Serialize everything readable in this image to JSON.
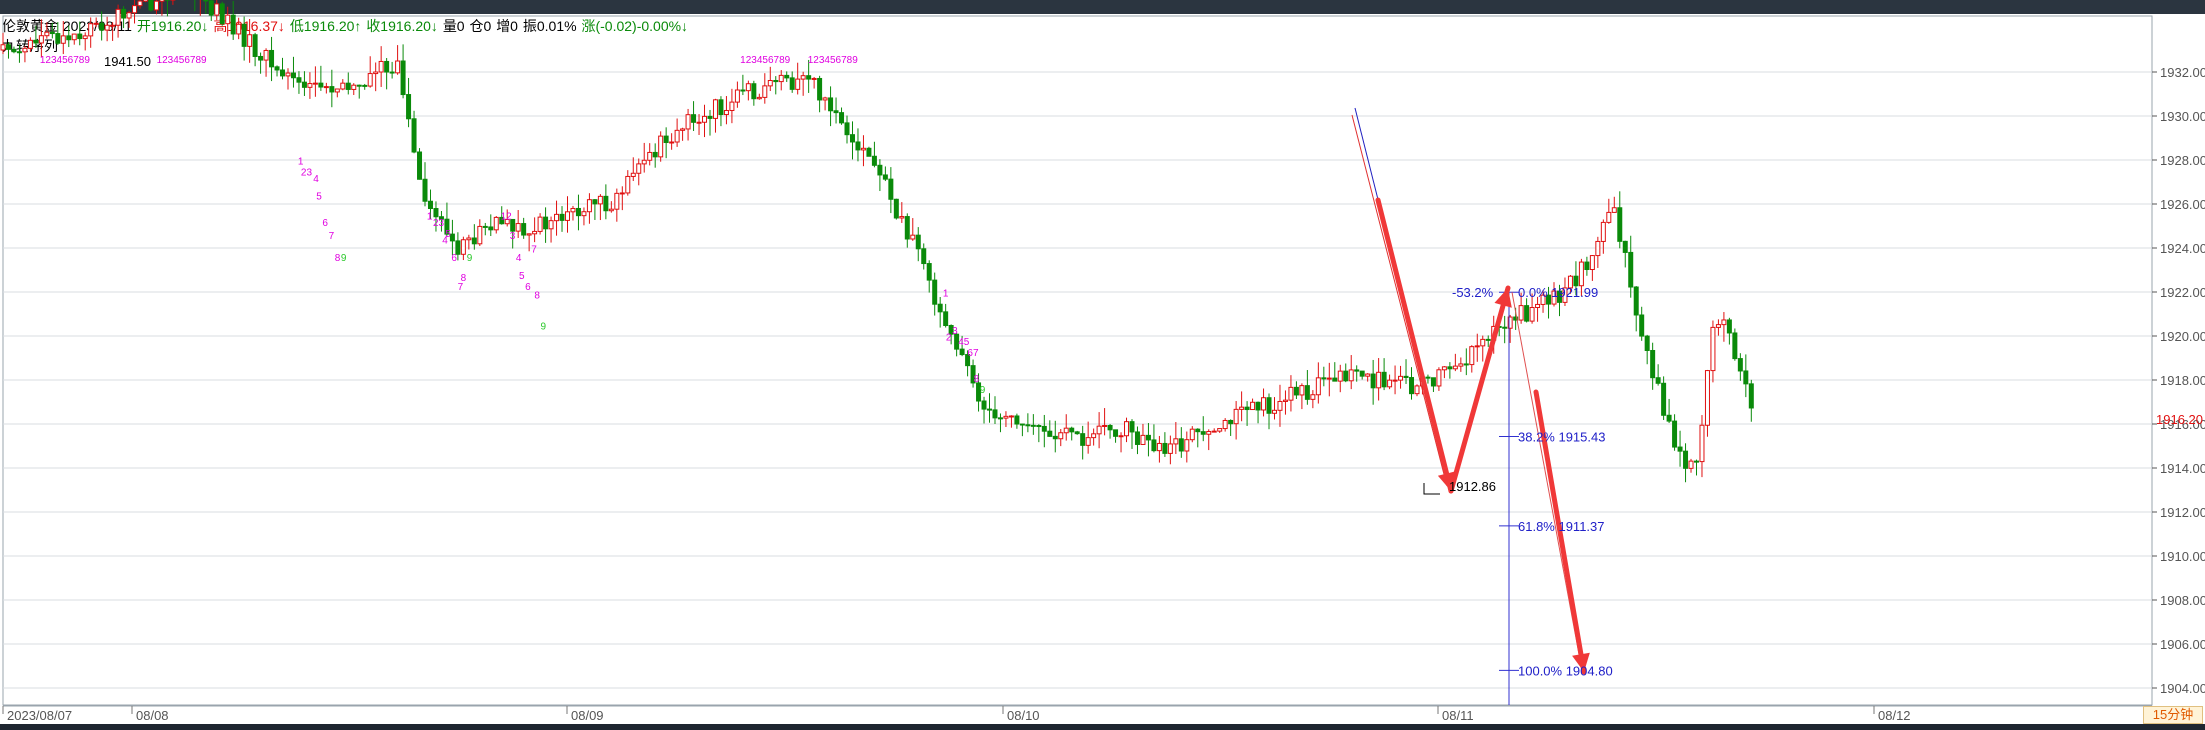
{
  "header": {
    "symbol": "伦敦黄金",
    "date": "2023/08/11",
    "open": "开1916.20↓",
    "high": "高1916.37↓",
    "low": "低1916.20↑",
    "close": "收1916.20↓",
    "volume": "量0",
    "position": "仓0",
    "increase": "增0",
    "amplitude": "振0.01%",
    "change": "涨(-0.02)-0.00%↓",
    "colors": {
      "up": "#e01010",
      "down": "#0a8a0a",
      "neutral": "#000000"
    }
  },
  "indicator": {
    "name": "九转序列"
  },
  "period": "15分钟",
  "last_price": "1916.20",
  "chart_data": {
    "type": "candlestick",
    "y_ticks": [
      "1932.00",
      "1930.00",
      "1928.00",
      "1926.00",
      "1924.00",
      "1922.00",
      "1920.00",
      "1918.00",
      "1916.00",
      "1914.00",
      "1912.00",
      "1910.00",
      "1908.00",
      "1906.00",
      "1904.00"
    ],
    "ylim": [
      1903.3,
      1933.3
    ],
    "x_labels": [
      "2023/08/07",
      "08/08",
      "08/09",
      "08/10",
      "08/11",
      "08/12"
    ],
    "grid": true,
    "close_path": [
      [
        0,
        1933
      ],
      [
        30,
        1934
      ],
      [
        60,
        1936
      ],
      [
        90,
        1932
      ],
      [
        110,
        1931
      ],
      [
        128,
        1932.5
      ],
      [
        138,
        1926
      ],
      [
        148,
        1924
      ],
      [
        160,
        1925
      ],
      [
        175,
        1925
      ],
      [
        185,
        1925.5
      ],
      [
        200,
        1926.3
      ],
      [
        215,
        1929
      ],
      [
        230,
        1930.2
      ],
      [
        245,
        1931.2
      ],
      [
        262,
        1931.8
      ],
      [
        275,
        1929.5
      ],
      [
        285,
        1927.5
      ],
      [
        300,
        1923
      ],
      [
        318,
        1917
      ],
      [
        335,
        1915.8
      ],
      [
        350,
        1915.3
      ],
      [
        365,
        1915.8
      ],
      [
        378,
        1914.6
      ],
      [
        392,
        1916
      ],
      [
        405,
        1916.5
      ],
      [
        420,
        1917.3
      ],
      [
        440,
        1918.3
      ],
      [
        460,
        1917.6
      ],
      [
        478,
        1919.2
      ],
      [
        490,
        1920.7
      ],
      [
        505,
        1921.7
      ],
      [
        516,
        1923.2
      ],
      [
        524,
        1925.8
      ],
      [
        530,
        1922.3
      ],
      [
        538,
        1918
      ],
      [
        546,
        1914.4
      ],
      [
        552,
        1914.2
      ],
      [
        556,
        1920.5
      ],
      [
        562,
        1920.2
      ],
      [
        567,
        1917.6
      ],
      [
        571,
        1916.4
      ]
    ],
    "candle_count": 320,
    "peak_label": "1941.50",
    "trough_label": "1912.86",
    "fibonacci": [
      {
        "ratio": "0.0%",
        "value": "1921.99",
        "label": "0.0% 1921.99",
        "price": 1921.99
      },
      {
        "ratio": "38.2%",
        "value": "1915.43",
        "label": "38.2% 1915.43",
        "price": 1915.43
      },
      {
        "ratio": "61.8%",
        "value": "1911.37",
        "label": "61.8% 1911.37",
        "price": 1911.37
      },
      {
        "ratio": "100.0%",
        "value": "1904.80",
        "label": "100.0% 1904.80",
        "price": 1904.8
      }
    ],
    "fib_extra_label": "-53.2%",
    "td_sequences": [
      {
        "text": "123456789",
        "color": "#e000e0",
        "price": 1932.4,
        "x": 12
      },
      {
        "text": "123456789",
        "color": "#e000e0",
        "price": 1932.4,
        "x": 50
      },
      {
        "text": "123456789",
        "color": "#e000e0",
        "price": 1932.4,
        "x": 240
      },
      {
        "text": "123456789",
        "color": "#e000e0",
        "price": 1932.4,
        "x": 262
      },
      {
        "text": "1",
        "color": "#e000e0",
        "price": 1927.8,
        "x": 96
      },
      {
        "text": "23",
        "color": "#e000e0",
        "price": 1927.3,
        "x": 97
      },
      {
        "text": "4",
        "color": "#e000e0",
        "price": 1927,
        "x": 101
      },
      {
        "text": "5",
        "color": "#e000e0",
        "price": 1926.2,
        "x": 102
      },
      {
        "text": "6",
        "color": "#e000e0",
        "price": 1925,
        "x": 104
      },
      {
        "text": "7",
        "color": "#e000e0",
        "price": 1924.4,
        "x": 106
      },
      {
        "text": "8",
        "color": "#e000e0",
        "price": 1923.4,
        "x": 108
      },
      {
        "text": "9",
        "color": "#2bc82b",
        "price": 1923.4,
        "x": 110
      },
      {
        "text": "1",
        "color": "#e000e0",
        "price": 1925.3,
        "x": 138
      },
      {
        "text": "23",
        "color": "#e000e0",
        "price": 1925,
        "x": 140
      },
      {
        "text": "5",
        "color": "#e000e0",
        "price": 1924.5,
        "x": 144
      },
      {
        "text": "4",
        "color": "#e000e0",
        "price": 1924.2,
        "x": 143
      },
      {
        "text": "6",
        "color": "#e000e0",
        "price": 1923.4,
        "x": 146
      },
      {
        "text": "9",
        "color": "#2bc82b",
        "price": 1923.4,
        "x": 151
      },
      {
        "text": "8",
        "color": "#e000e0",
        "price": 1922.5,
        "x": 149
      },
      {
        "text": "7",
        "color": "#e000e0",
        "price": 1922.1,
        "x": 148
      },
      {
        "text": "12",
        "color": "#e000e0",
        "price": 1925.3,
        "x": 162
      },
      {
        "text": "3",
        "color": "#e000e0",
        "price": 1924.4,
        "x": 165
      },
      {
        "text": "7",
        "color": "#e000e0",
        "price": 1923.8,
        "x": 172
      },
      {
        "text": "4",
        "color": "#e000e0",
        "price": 1923.4,
        "x": 167
      },
      {
        "text": "5",
        "color": "#e000e0",
        "price": 1922.6,
        "x": 168
      },
      {
        "text": "6",
        "color": "#e000e0",
        "price": 1922.1,
        "x": 170
      },
      {
        "text": "8",
        "color": "#e000e0",
        "price": 1921.7,
        "x": 173
      },
      {
        "text": "9",
        "color": "#2bc82b",
        "price": 1920.3,
        "x": 175
      },
      {
        "text": "1",
        "color": "#e000e0",
        "price": 1921.8,
        "x": 306
      },
      {
        "text": "2",
        "color": "#e000e0",
        "price": 1919.8,
        "x": 307
      },
      {
        "text": "3",
        "color": "#e000e0",
        "price": 1920.1,
        "x": 309
      },
      {
        "text": "45",
        "color": "#e000e0",
        "price": 1919.6,
        "x": 311
      },
      {
        "text": "67",
        "color": "#e000e0",
        "price": 1919.1,
        "x": 314
      },
      {
        "text": "8",
        "color": "#e000e0",
        "price": 1917.9,
        "x": 316
      },
      {
        "text": "9",
        "color": "#2bc82b",
        "price": 1917.4,
        "x": 318
      }
    ]
  }
}
